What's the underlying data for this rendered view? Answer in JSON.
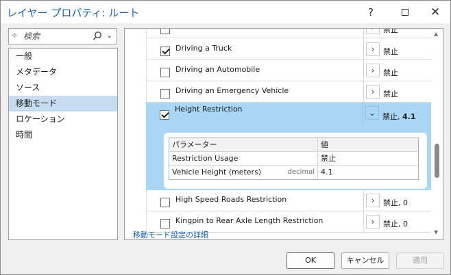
{
  "window": {
    "title": "レイヤー プロパティ: ルート",
    "help_glyph": "?",
    "close_glyph": "✕"
  },
  "search": {
    "placeholder": "検索"
  },
  "sidebar": {
    "items": [
      {
        "label": "一般",
        "selected": false
      },
      {
        "label": "メタデータ",
        "selected": false
      },
      {
        "label": "ソース",
        "selected": false
      },
      {
        "label": "移動モード",
        "selected": true
      },
      {
        "label": "ロケーション",
        "selected": false
      },
      {
        "label": "時間",
        "selected": false
      }
    ]
  },
  "restrictions": {
    "top_partial": {
      "value": "禁止",
      "checked": false
    },
    "rows": [
      {
        "label": "Driving a Truck",
        "checked": true,
        "value": "禁止"
      },
      {
        "label": "Driving an Automobile",
        "checked": false,
        "value": "禁止"
      },
      {
        "label": "Driving an Emergency Vehicle",
        "checked": false,
        "value": "禁止"
      }
    ],
    "expanded": {
      "label": "Height Restriction",
      "checked": true,
      "value_prefix": "禁止, ",
      "value_bold": "4.1"
    },
    "params": {
      "header": {
        "name": "パラメーター",
        "value": "値"
      },
      "rows": [
        {
          "name": "Restriction Usage",
          "unit": "",
          "value": "禁止"
        },
        {
          "name": "Vehicle Height (meters)",
          "unit": "decimal",
          "value": "4.1"
        }
      ]
    },
    "rows_after": [
      {
        "label": "High Speed Roads Restriction",
        "checked": false,
        "value": "禁止, 0"
      },
      {
        "label": "Kingpin to Rear Axle Length Restriction",
        "checked": false,
        "value": "禁止, 0"
      }
    ]
  },
  "link": {
    "label": "移動モード設定の詳細"
  },
  "buttons": {
    "ok": "OK",
    "cancel": "キャンセル",
    "apply": "適用"
  }
}
